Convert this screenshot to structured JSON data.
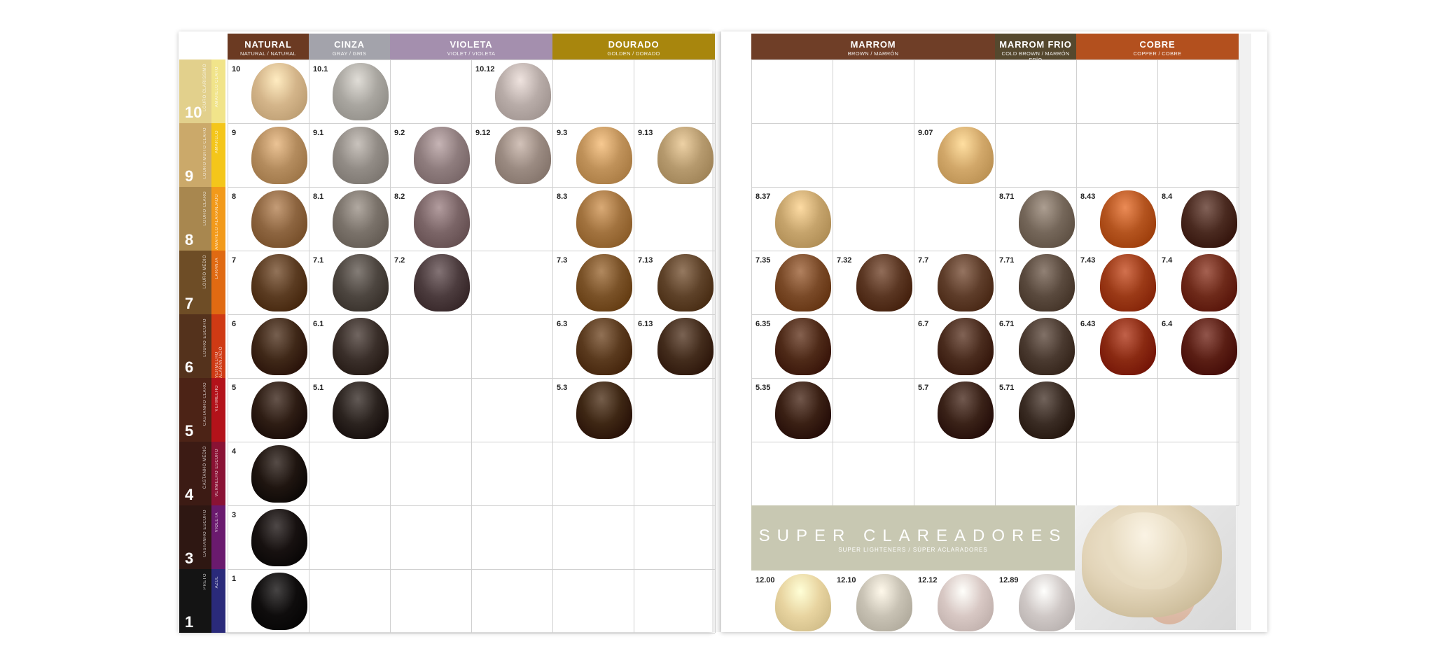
{
  "columns_left": [
    {
      "title": "NATURAL",
      "subtitle": "NATURAL / NATURAL",
      "color": "#6b3a22",
      "span": 1
    },
    {
      "title": "CINZA",
      "subtitle": "GRAY / GRIS",
      "color": "#a3a3ab",
      "span": 1
    },
    {
      "title": "VIOLETA",
      "subtitle": "VIOLET / VIOLETA",
      "color": "#a48fae",
      "span": 2
    },
    {
      "title": "DOURADO",
      "subtitle": "GOLDEN / DORADO",
      "color": "#a8860d",
      "span": 2
    }
  ],
  "columns_right": [
    {
      "title": "MARROM",
      "subtitle": "BROWN / MARRÓN",
      "color": "#6f3e27",
      "span": 3
    },
    {
      "title": "MARROM FRIO",
      "subtitle": "COLD BROWN / MARRÓN FRÍO",
      "color": "#55482e",
      "span": 1
    },
    {
      "title": "COBRE",
      "subtitle": "COPPER / COBRE",
      "color": "#b3501e",
      "span": 2
    }
  ],
  "levels": [
    {
      "num": "10",
      "name": "LOURO CLARÍSSIMO",
      "strip": "AMARELO CLARO",
      "color": "#e2d08c",
      "strip_color": "#f1e48a"
    },
    {
      "num": "9",
      "name": "LOURO MUITO CLARO",
      "strip": "AMARELO",
      "color": "#cba96a",
      "strip_color": "#f4c61a"
    },
    {
      "num": "8",
      "name": "LOURO CLARO",
      "strip": "AMARELO ALARANJADO",
      "color": "#a8874f",
      "strip_color": "#f29a1a"
    },
    {
      "num": "7",
      "name": "LOURO MÉDIO",
      "strip": "LARANJA",
      "color": "#6e4d26",
      "strip_color": "#e06a12"
    },
    {
      "num": "6",
      "name": "LOURO ESCURO",
      "strip": "VERMELHO ALARANJADO",
      "color": "#54321c",
      "strip_color": "#cf3a14"
    },
    {
      "num": "5",
      "name": "CASTANHO CLARO",
      "strip": "VERMELHO",
      "color": "#4c2316",
      "strip_color": "#b3121a"
    },
    {
      "num": "4",
      "name": "CASTANHO MÉDIO",
      "strip": "VERMELHO ESCURO",
      "color": "#3c1b14",
      "strip_color": "#8a1234"
    },
    {
      "num": "3",
      "name": "CASTANHO ESCURO",
      "strip": "VIOLETA",
      "color": "#2e1712",
      "strip_color": "#6a1a6e"
    },
    {
      "num": "1",
      "name": "PRETO",
      "strip": "AZUL",
      "color": "#141414",
      "strip_color": "#2a2a7a"
    }
  ],
  "left_swatches": [
    [
      "10",
      "10.1",
      "",
      "10.12",
      "",
      ""
    ],
    [
      "9",
      "9.1",
      "9.2",
      "9.12",
      "9.3",
      "9.13"
    ],
    [
      "8",
      "8.1",
      "8.2",
      "",
      "8.3",
      ""
    ],
    [
      "7",
      "7.1",
      "7.2",
      "",
      "7.3",
      "7.13"
    ],
    [
      "6",
      "6.1",
      "",
      "",
      "6.3",
      "6.13"
    ],
    [
      "5",
      "5.1",
      "",
      "",
      "5.3",
      ""
    ],
    [
      "4",
      "",
      "",
      "",
      "",
      ""
    ],
    [
      "3",
      "",
      "",
      "",
      "",
      ""
    ],
    [
      "1",
      "",
      "",
      "",
      "",
      ""
    ]
  ],
  "right_swatches": [
    [
      "",
      "",
      "",
      "",
      "",
      ""
    ],
    [
      "",
      "",
      "9.07",
      "",
      "",
      ""
    ],
    [
      "8.37",
      "",
      "",
      "8.71",
      "8.43",
      "8.4"
    ],
    [
      "7.35",
      "7.32",
      "7.7",
      "7.71",
      "7.43",
      "7.4"
    ],
    [
      "6.35",
      "",
      "6.7",
      "6.71",
      "6.43",
      "6.4"
    ],
    [
      "5.35",
      "",
      "5.7",
      "5.71",
      "",
      ""
    ],
    [
      "",
      "",
      "",
      "",
      "",
      ""
    ]
  ],
  "swatch_colors": {
    "10": "#d4b58a",
    "10.1": "#a9a6a0",
    "10.12": "#b8aca8",
    "9": "#b48c5e",
    "9.1": "#928c86",
    "9.2": "#8f7d7e",
    "9.12": "#9b8b82",
    "9.3": "#c0925a",
    "9.13": "#b69a6e",
    "8": "#8d6540",
    "8.1": "#7a726a",
    "8.2": "#7b6567",
    "8.3": "#a2733f",
    "7": "#5b3c22",
    "7.1": "#4d4640",
    "7.2": "#4c3c3e",
    "7.3": "#7a5228",
    "7.13": "#5e4229",
    "6": "#3f2818",
    "6.1": "#3a2f2a",
    "6.3": "#5a3a1e",
    "6.13": "#432c1c",
    "5": "#2e1d14",
    "5.1": "#2b231f",
    "5.3": "#3e2714",
    "4": "#1f1510",
    "3": "#171110",
    "1": "#0f0d0d",
    "9.07": "#d2a86a",
    "8.37": "#c6a46c",
    "8.71": "#75675a",
    "8.43": "#b4541f",
    "8.4": "#4a2a20",
    "7.35": "#7a4a28",
    "7.32": "#5a3622",
    "7.7": "#5e3d2a",
    "7.71": "#5a4a3e",
    "7.43": "#9b3a17",
    "7.4": "#6e2a1a",
    "6.35": "#4e2a18",
    "6.7": "#4a2c1e",
    "6.71": "#4a3a30",
    "6.43": "#8a2a12",
    "6.4": "#5a1e14",
    "5.35": "#3a2014",
    "5.7": "#3a2218",
    "5.71": "#3a2c24",
    "12.00": "#e8d4a0",
    "12.10": "#c8c2b4",
    "12.12": "#d8c8c4",
    "12.89": "#cfc8c6"
  },
  "super": {
    "title": "SUPER CLAREADORES",
    "subtitle": "SUPER LIGHTENERS / SÚPER ACLARADORES",
    "swatches": [
      "12.00",
      "12.10",
      "12.12",
      "12.89"
    ]
  }
}
